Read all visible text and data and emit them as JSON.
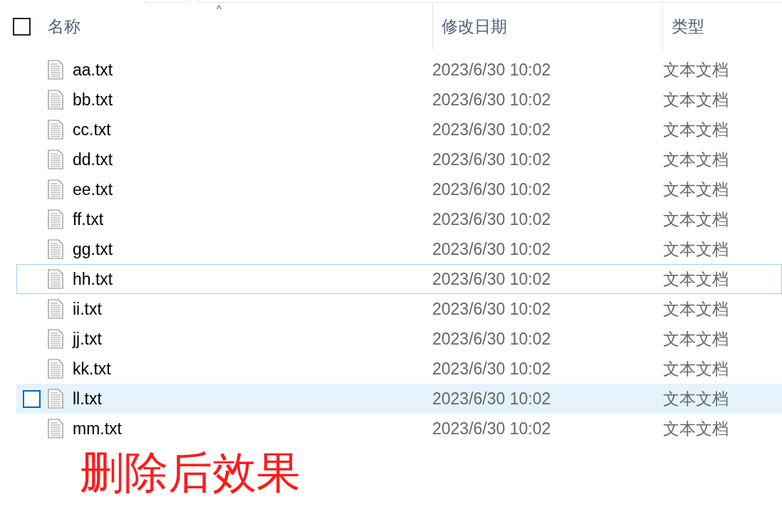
{
  "header": {
    "sort_caret": "^",
    "checkbox": {
      "checked": false
    },
    "columns": [
      "名称",
      "修改日期",
      "类型"
    ]
  },
  "rows": [
    {
      "name": "aa.txt",
      "date": "2023/6/30 10:02",
      "type": "文本文档",
      "hovered": false,
      "focused": false
    },
    {
      "name": "bb.txt",
      "date": "2023/6/30 10:02",
      "type": "文本文档",
      "hovered": false,
      "focused": false
    },
    {
      "name": "cc.txt",
      "date": "2023/6/30 10:02",
      "type": "文本文档",
      "hovered": false,
      "focused": false
    },
    {
      "name": "dd.txt",
      "date": "2023/6/30 10:02",
      "type": "文本文档",
      "hovered": false,
      "focused": false
    },
    {
      "name": "ee.txt",
      "date": "2023/6/30 10:02",
      "type": "文本文档",
      "hovered": false,
      "focused": false
    },
    {
      "name": "ff.txt",
      "date": "2023/6/30 10:02",
      "type": "文本文档",
      "hovered": false,
      "focused": false
    },
    {
      "name": "gg.txt",
      "date": "2023/6/30 10:02",
      "type": "文本文档",
      "hovered": false,
      "focused": false
    },
    {
      "name": "hh.txt",
      "date": "2023/6/30 10:02",
      "type": "文本文档",
      "hovered": false,
      "focused": true
    },
    {
      "name": "ii.txt",
      "date": "2023/6/30 10:02",
      "type": "文本文档",
      "hovered": false,
      "focused": false
    },
    {
      "name": "jj.txt",
      "date": "2023/6/30 10:02",
      "type": "文本文档",
      "hovered": false,
      "focused": false
    },
    {
      "name": "kk.txt",
      "date": "2023/6/30 10:02",
      "type": "文本文档",
      "hovered": false,
      "focused": false
    },
    {
      "name": "ll.txt",
      "date": "2023/6/30 10:02",
      "type": "文本文档",
      "hovered": true,
      "focused": false
    },
    {
      "name": "mm.txt",
      "date": "2023/6/30 10:02",
      "type": "文本文档",
      "hovered": false,
      "focused": false
    }
  ],
  "caption": "删除后效果"
}
